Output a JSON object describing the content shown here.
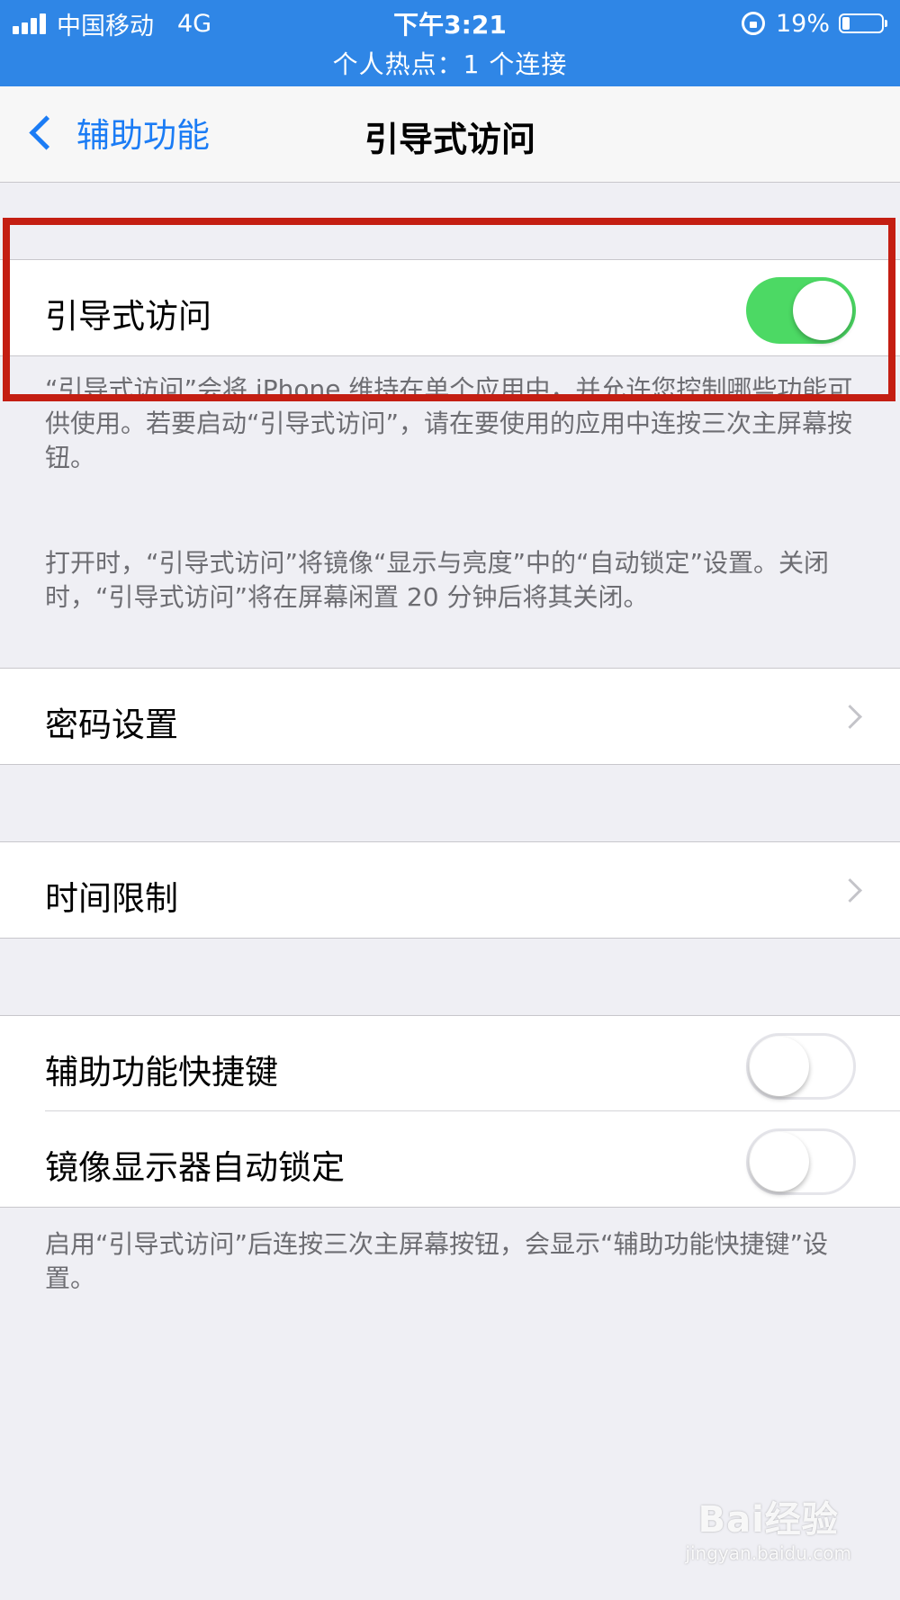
{
  "status_bar": {
    "carrier": "中国移动",
    "network": "4G",
    "time": "下午3:21",
    "battery": "19%",
    "hotspot": "个人热点：1 个连接"
  },
  "nav": {
    "back_label": "辅助功能",
    "title": "引导式访问"
  },
  "guided_access": {
    "label": "引导式访问",
    "enabled": true,
    "footer_1": "“引导式访问”会将 iPhone 维持在单个应用中，并允许您控制哪些功能可供使用。若要启动“引导式访问”，请在要使用的应用中连按三次主屏幕按钮。",
    "footer_2": "打开时，“引导式访问”将镜像“显示与亮度”中的“自动锁定”设置。关闭时，“引导式访问”将在屏幕闲置 20 分钟后将其关闭。"
  },
  "passcode_settings": {
    "label": "密码设置"
  },
  "time_limits": {
    "label": "时间限制"
  },
  "shortcuts": {
    "accessibility_shortcut": {
      "label": "辅助功能快捷键",
      "enabled": false
    },
    "mirror_auto_lock": {
      "label": "镜像显示器自动锁定",
      "enabled": false
    },
    "footer": "启用“引导式访问”后连按三次主屏幕按钮，会显示“辅助功能快捷键”设置。"
  },
  "watermark": {
    "brand": "Bai经验",
    "domain": "jingyan.baidu.com"
  },
  "colors": {
    "status_bar": "#2f86e6",
    "accent": "#1b7cf5",
    "switch_on": "#4cd964",
    "highlight": "#c41e12"
  }
}
